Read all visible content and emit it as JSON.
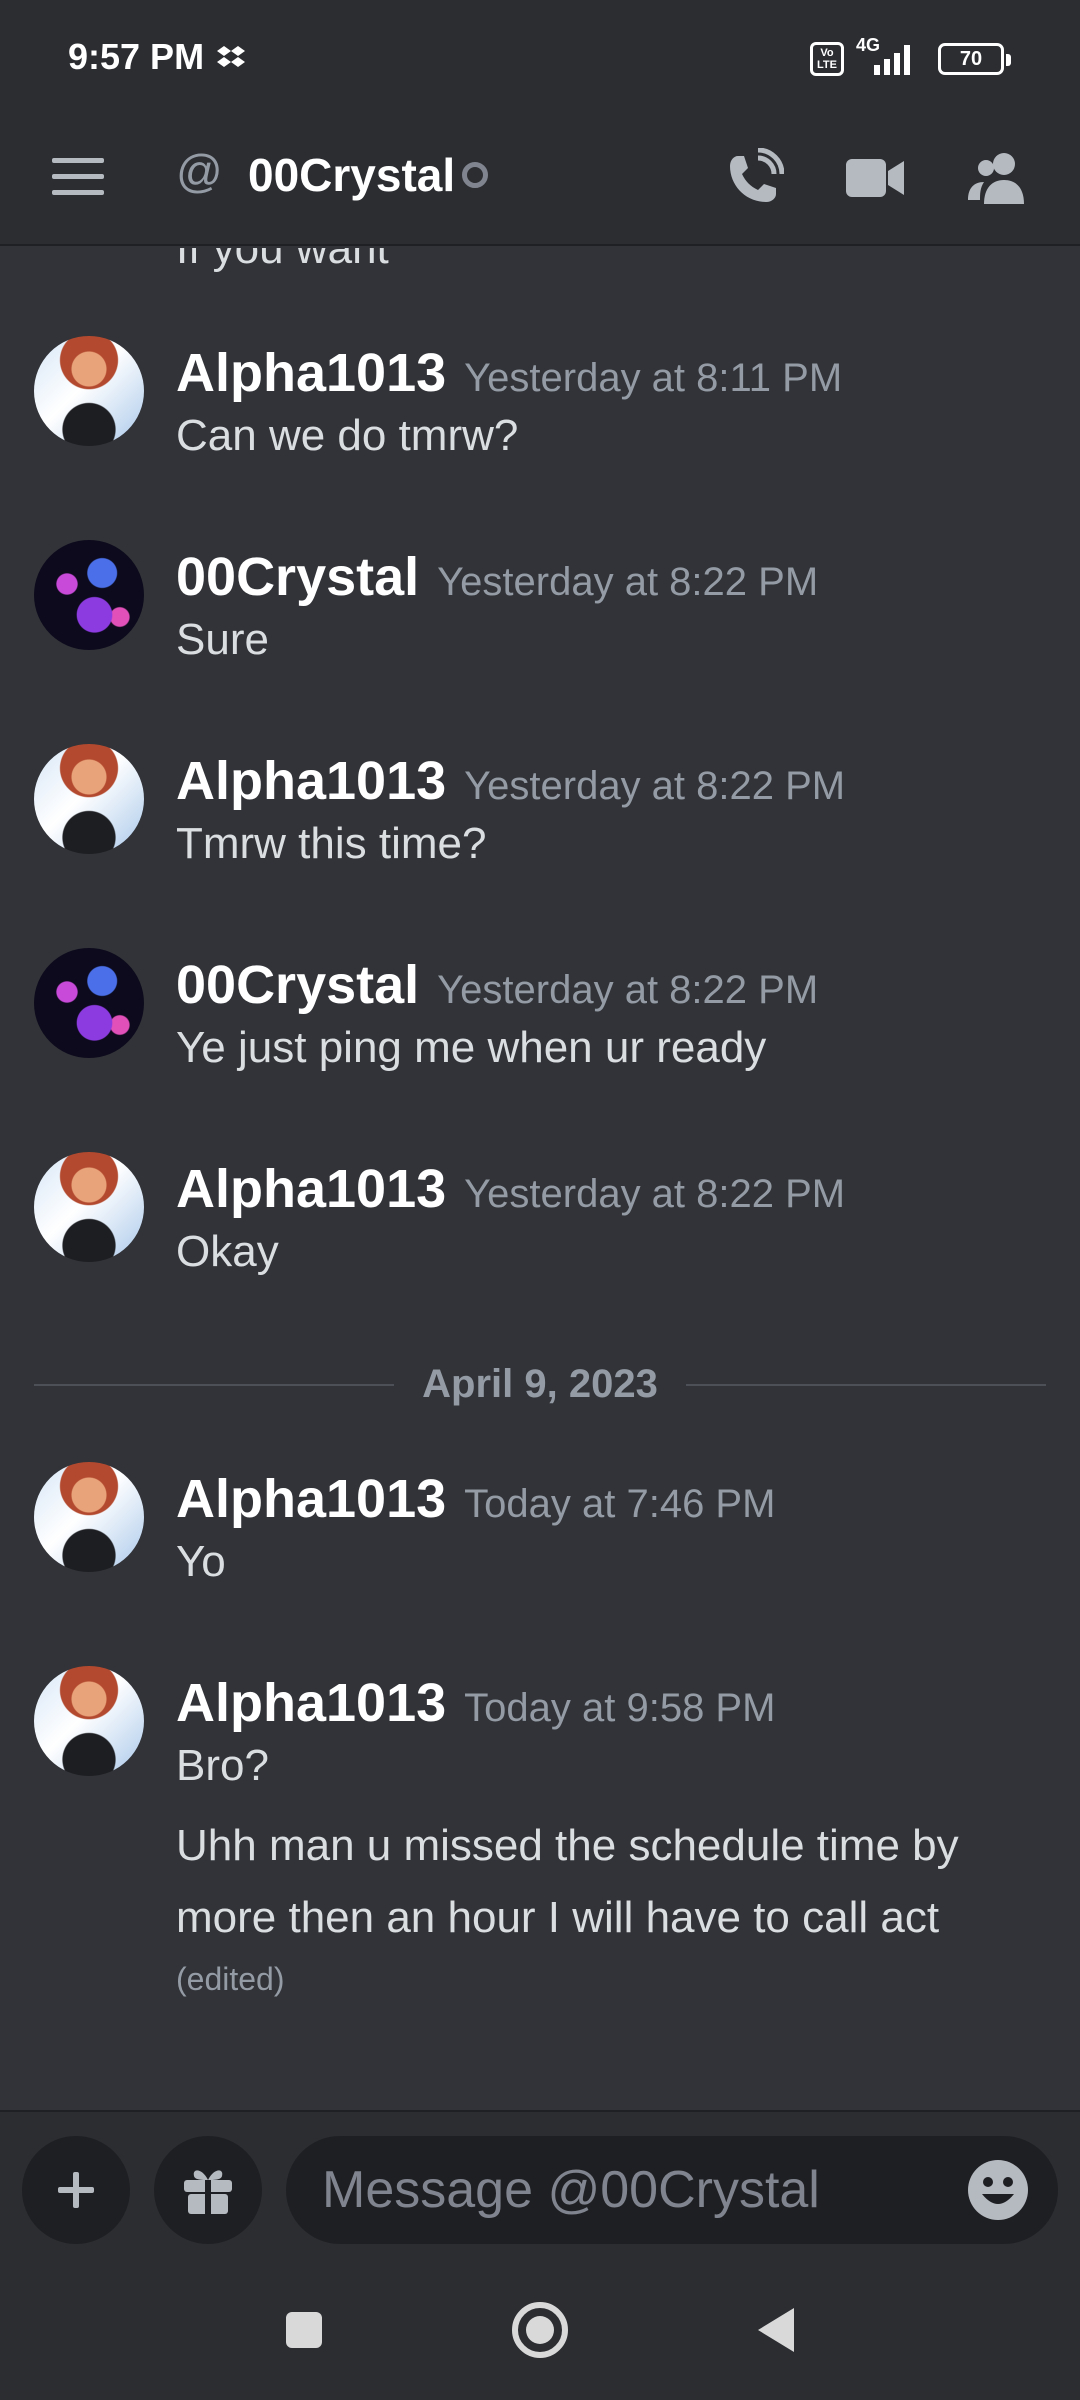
{
  "status_bar": {
    "time": "9:57 PM",
    "volte": "Vo LTE",
    "network": "4G",
    "battery": "70"
  },
  "header": {
    "channel_name": "00Crystal"
  },
  "messages": {
    "cutoff_text": "If you want",
    "items": [
      {
        "author": "Alpha1013",
        "time": "Yesterday at 8:11 PM",
        "text": "Can we do tmrw?"
      },
      {
        "author": "00Crystal",
        "time": "Yesterday at 8:22 PM",
        "text": "Sure"
      },
      {
        "author": "Alpha1013",
        "time": "Yesterday at 8:22 PM",
        "text": "Tmrw this time?"
      },
      {
        "author": "00Crystal",
        "time": "Yesterday at 8:22 PM",
        "text": "Ye just ping me when ur ready"
      },
      {
        "author": "Alpha1013",
        "time": "Yesterday at 8:22 PM",
        "text": "Okay"
      },
      {
        "author": "Alpha1013",
        "time": "Today at 7:46 PM",
        "text": "Yo"
      },
      {
        "author": "Alpha1013",
        "time": "Today at 9:58 PM",
        "text": "Bro?",
        "extra_text": "Uhh man u missed the schedule time by more then an hour I will have to call act",
        "edited": "(edited)"
      }
    ],
    "date_divider": "April 9, 2023"
  },
  "composer": {
    "placeholder": "Message @00Crystal"
  },
  "colors": {
    "background": "#313338",
    "header": "#2b2d31",
    "input": "#1e1f22",
    "muted": "#949ba4"
  }
}
